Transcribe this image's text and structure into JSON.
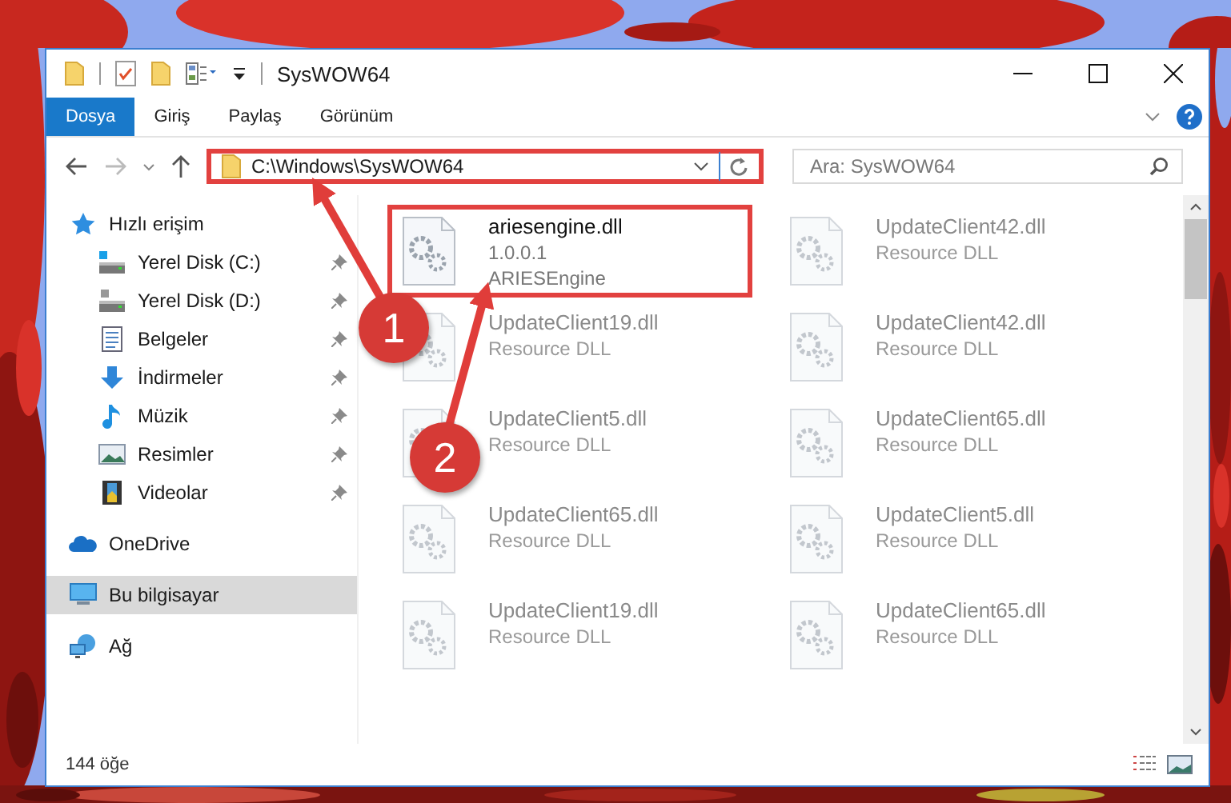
{
  "window": {
    "title": "SysWOW64"
  },
  "ribbon_tabs": [
    {
      "label": "Dosya",
      "selected": true
    },
    {
      "label": "Giriş",
      "selected": false
    },
    {
      "label": "Paylaş",
      "selected": false
    },
    {
      "label": "Görünüm",
      "selected": false
    }
  ],
  "address": {
    "path": "C:\\Windows\\SysWOW64",
    "highlighted": true
  },
  "search": {
    "placeholder": "Ara: SysWOW64"
  },
  "sidebar": {
    "items": [
      {
        "label": "Hızlı erişim",
        "kind": "star",
        "selected": false,
        "children": [
          {
            "label": "Yerel Disk (C:)",
            "kind": "system-drive",
            "pinned": true
          },
          {
            "label": "Yerel Disk (D:)",
            "kind": "drive",
            "pinned": true
          },
          {
            "label": "Belgeler",
            "kind": "documents",
            "pinned": true
          },
          {
            "label": "İndirmeler",
            "kind": "download",
            "pinned": true
          },
          {
            "label": "Müzik",
            "kind": "music",
            "pinned": true
          },
          {
            "label": "Resimler",
            "kind": "pictures",
            "pinned": true
          },
          {
            "label": "Videolar",
            "kind": "videos",
            "pinned": true
          }
        ]
      },
      {
        "label": "OneDrive",
        "kind": "cloud",
        "selected": false
      },
      {
        "label": "Bu bilgisayar",
        "kind": "computer",
        "selected": true
      },
      {
        "label": "Ağ",
        "kind": "network",
        "selected": false
      }
    ]
  },
  "files": [
    {
      "name": "ariesengine.dll",
      "details": [
        "1.0.0.1",
        "ARIESEngine"
      ],
      "highlighted": true,
      "blurred": false
    },
    {
      "name": "UpdateClient42.dll",
      "details": [
        "Resource DLL"
      ],
      "highlighted": false,
      "blurred": true
    },
    {
      "name": "UpdateClient19.dll",
      "details": [
        "Resource DLL"
      ],
      "highlighted": false,
      "blurred": true
    },
    {
      "name": "UpdateClient42.dll",
      "details": [
        "Resource DLL"
      ],
      "highlighted": false,
      "blurred": true
    },
    {
      "name": "UpdateClient5.dll",
      "details": [
        "Resource DLL"
      ],
      "highlighted": false,
      "blurred": true
    },
    {
      "name": "UpdateClient65.dll",
      "details": [
        "Resource DLL"
      ],
      "highlighted": false,
      "blurred": true
    },
    {
      "name": "UpdateClient65.dll",
      "details": [
        "Resource DLL"
      ],
      "highlighted": false,
      "blurred": true
    },
    {
      "name": "UpdateClient5.dll",
      "details": [
        "Resource DLL"
      ],
      "highlighted": false,
      "blurred": true
    },
    {
      "name": "UpdateClient19.dll",
      "details": [
        "Resource DLL"
      ],
      "highlighted": false,
      "blurred": true
    },
    {
      "name": "UpdateClient65.dll",
      "details": [
        "Resource DLL"
      ],
      "highlighted": false,
      "blurred": true
    }
  ],
  "status_bar": {
    "item_count": "144 öğe"
  },
  "annotations": [
    {
      "label": "1"
    },
    {
      "label": "2"
    }
  ]
}
